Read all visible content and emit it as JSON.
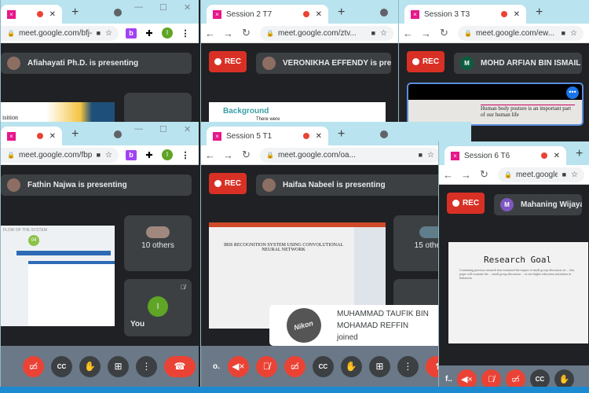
{
  "colors": {
    "tabstrip": "#b9e3ee",
    "meet_bg": "#202124",
    "rec": "#d93025",
    "control_red": "#ea4335",
    "control_bar": "#6a7888",
    "taskbar": "#1c8ad0"
  },
  "common": {
    "rec_label": "REC",
    "ext_b": "b",
    "profile_initial": "I"
  },
  "windows": [
    {
      "tab_title": "",
      "url": "meet.google.com/bfj-...",
      "presenter": "Afiahayati Ph.D. is presenting",
      "slide_text": "isition",
      "has_rec": false,
      "extensions": true
    },
    {
      "tab_title": "Session 2 T7",
      "url": "meet.google.com/ztv...",
      "presenter": "VERONIKHA EFFENDY is presenting",
      "slide_title": "Background",
      "slide_text": "There were",
      "has_rec": true,
      "extensions": false
    },
    {
      "tab_title": "Session 3 T3",
      "url": "meet.google.com/ew...",
      "presenter": "MOHD ARFIAN BIN ISMAIL is presenting",
      "avatar_letter": "M",
      "avatar_color": "#0b5e3f",
      "slide_text": "Human body posture is an important part of our human life",
      "has_rec": true,
      "extensions": false
    },
    {
      "tab_title": "",
      "url": "meet.google.com/fbp...",
      "presenter": "Fathin Najwa is presenting",
      "slide_title": "FLOW OF THE SYSTEM",
      "slide_badge": "04",
      "others": "10 others",
      "you_label": "You",
      "you_initial": "I",
      "has_rec": false,
      "extensions": true,
      "controls": [
        "camera-off",
        "captions",
        "raise-hand",
        "present",
        "more",
        "end-call"
      ]
    },
    {
      "tab_title": "Session 5 T1",
      "url": "meet.google.com/oa...",
      "presenter": "Haifaa Nabeel is presenting",
      "slide_title": "IRIS RECOGNITION SYSTEM USING CONVOLUTIONAL NEURAL NETWORK",
      "others": "15 others",
      "self_label": "o.",
      "toast_text": "MUHAMMAD TAUFIK BIN MOHAMAD REFFIN joined",
      "toast_avatar_text": "Nikon",
      "has_rec": true,
      "extensions": false,
      "controls": [
        "speaker-mute",
        "mic-off",
        "camera-off",
        "captions",
        "raise-hand",
        "present",
        "more",
        "end-call"
      ]
    },
    {
      "tab_title": "Session 6 T6",
      "url": "meet.google.com/fob...",
      "presenter": "Mahaning Wijaya is presenting",
      "avatar_letter": "M",
      "avatar_color": "#7e57c2",
      "slide_title": "Research Goal",
      "slide_text": "Continuing previous research that examined the impact of small group discussion on ... this paper will examine the ... small group discussion ... in one higher education institution in Indonesia.",
      "self_label": "f..",
      "has_rec": true,
      "extensions": false,
      "controls": [
        "speaker-mute",
        "mic-off",
        "camera-off",
        "captions",
        "raise-hand"
      ]
    }
  ]
}
